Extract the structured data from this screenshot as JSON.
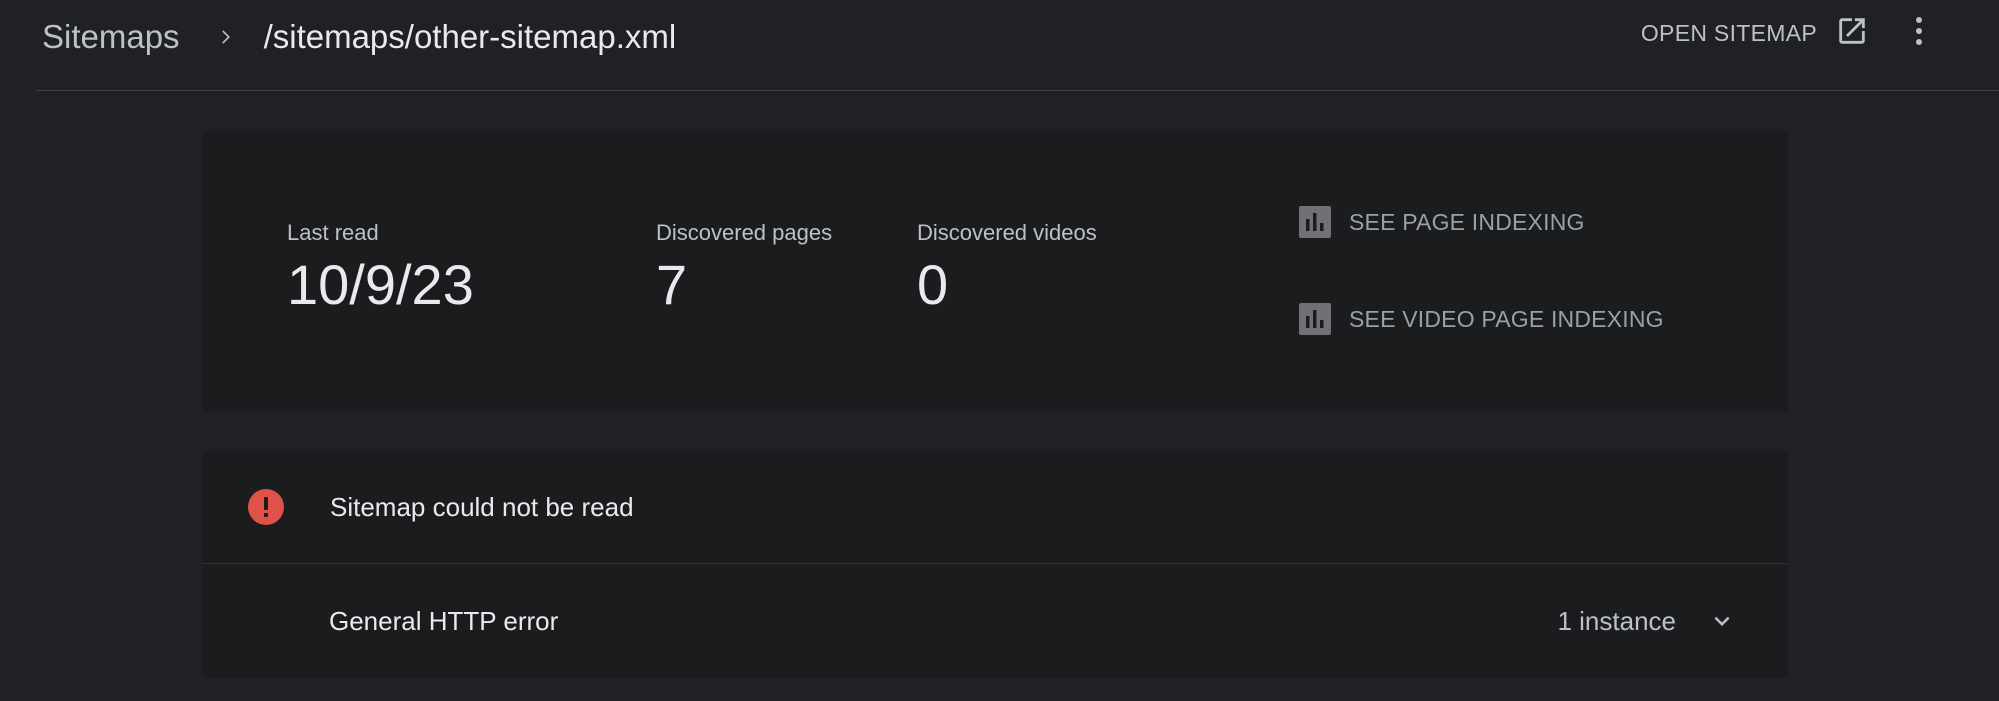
{
  "header": {
    "breadcrumb_root": "Sitemaps",
    "breadcrumb_current": "/sitemaps/other-sitemap.xml",
    "open_sitemap_label": "OPEN SITEMAP"
  },
  "stats": [
    {
      "label": "Last read",
      "value": "10/9/23"
    },
    {
      "label": "Discovered pages",
      "value": "7"
    },
    {
      "label": "Discovered videos",
      "value": "0"
    }
  ],
  "links": [
    {
      "label": "SEE PAGE INDEXING",
      "icon": "bar-chart-icon"
    },
    {
      "label": "SEE VIDEO PAGE INDEXING",
      "icon": "bar-chart-icon"
    }
  ],
  "error": {
    "title": "Sitemap could not be read",
    "icon": "error-icon",
    "icon_color": "#e0514a",
    "details": [
      {
        "label": "General HTTP error",
        "count": "1 instance"
      }
    ]
  },
  "colors": {
    "background": "#202124",
    "card": "#1b1c1e",
    "text_primary": "#e8eaed",
    "text_secondary": "#bdc1c6",
    "link_muted": "#9aa0a6"
  }
}
